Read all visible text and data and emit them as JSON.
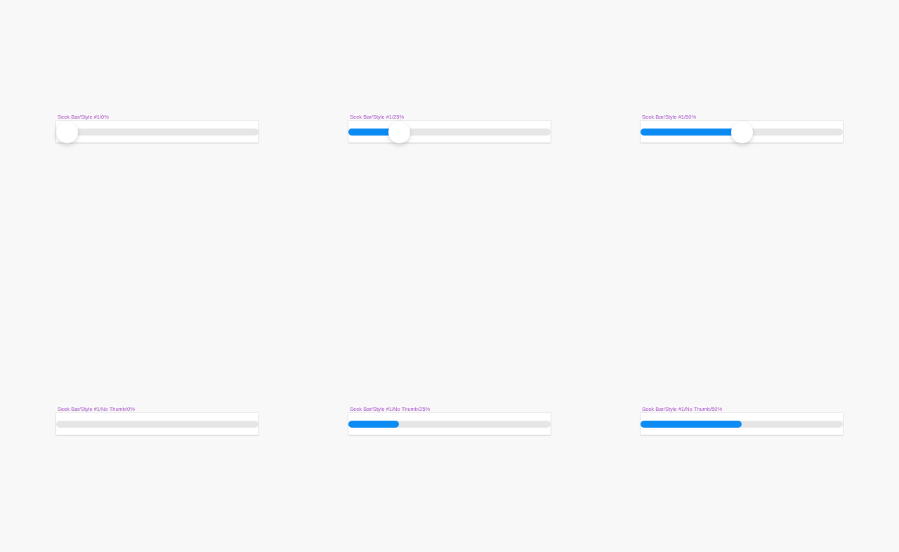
{
  "seek_bars": [
    {
      "label": "Seek Bar/Style #1/0%",
      "thumb": true,
      "level": 0
    },
    {
      "label": "Seek Bar/Style #1/25%",
      "thumb": true,
      "level": 0.25
    },
    {
      "label": "Seek Bar/Style #1/50%",
      "thumb": true,
      "level": 0.5
    },
    {
      "label": "Seek Bar/Style #1/No Thumb/0%",
      "thumb": false
    },
    {
      "label": "Seek Bar/Style #1/No Thumb/25%",
      "thumb": false,
      "level": 0.25
    },
    {
      "label": "Seek Bar/Style #1/No Thumb/50%",
      "thumb": false,
      "level": 0.5
    }
  ]
}
